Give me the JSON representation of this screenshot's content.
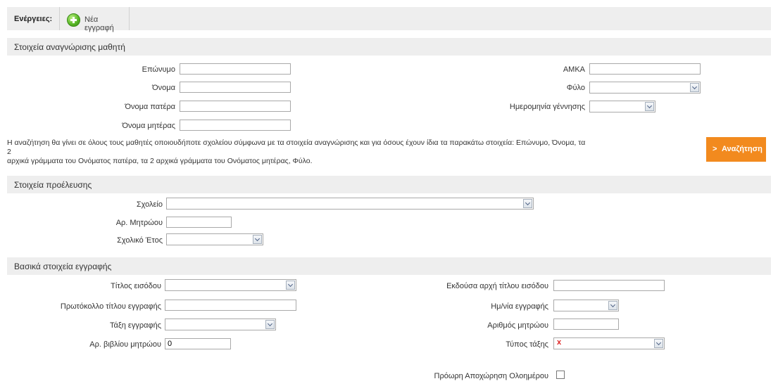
{
  "toolbar": {
    "actions_label": "Ενέργειες:",
    "new_record_label": "Νέα εγγραφή"
  },
  "section_identification": {
    "title": "Στοιχεία αναγνώρισης μαθητή",
    "surname_label": "Επώνυμο",
    "surname_value": "",
    "name_label": "Όνομα",
    "name_value": "",
    "father_name_label": "Όνομα πατέρα",
    "father_name_value": "",
    "mother_name_label": "Όνομα μητέρας",
    "mother_name_value": "",
    "amka_label": "ΑΜΚΑ",
    "amka_value": "",
    "gender_label": "Φύλο",
    "gender_value": "",
    "birthdate_label": "Ημερομηνία γέννησης",
    "birthdate_value": "",
    "note_line1": "Η αναζήτηση θα γίνει σε όλους τους μαθητές οποιουδήποτε σχολείου σύμφωνα με τα στοιχεία αναγνώρισης και για όσους έχουν ίδια τα παρακάτω στοιχεία: Επώνυμο, Όνομα, τα 2",
    "note_line2": "αρχικά γράμματα του Ονόματος πατέρα, τα 2 αρχικά γράμματα του Ονόματος μητέρας, Φύλο.",
    "search_button_chevron": ">",
    "search_button_label": "Αναζήτηση"
  },
  "section_origin": {
    "title": "Στοιχεία προέλευσης",
    "school_label": "Σχολείο",
    "school_value": "",
    "registry_no_label": "Αρ. Μητρώου",
    "registry_no_value": "",
    "school_year_label": "Σχολικό Έτος",
    "school_year_value": ""
  },
  "section_registration": {
    "title": "Βασικά στοιχεία εγγραφής",
    "entry_title_label": "Τίτλος εισόδου",
    "entry_title_value": "",
    "protocol_label": "Πρωτόκολλο τίτλου εγγραφής",
    "protocol_value": "",
    "grade_label": "Τάξη εγγραφής",
    "grade_value": "",
    "book_no_label": "Αρ. βιβλίου μητρώου",
    "book_no_value": "0",
    "issuing_authority_label": "Εκδούσα αρχή τίτλου εισόδου",
    "issuing_authority_value": "",
    "reg_date_label": "Ημ/νία εγγραφής",
    "reg_date_value": "",
    "registry_number_label": "Αριθμός μητρώου",
    "registry_number_value": "",
    "class_type_label": "Τύπος τάξης",
    "class_type_value": "x",
    "early_leave_label": "Πρόωρη Αποχώρηση Ολοημέρου",
    "early_leave_checked": false
  },
  "colors": {
    "section_bg": "#eeeeee",
    "accent_button": "#f28a1e",
    "add_icon": "#55b424"
  }
}
